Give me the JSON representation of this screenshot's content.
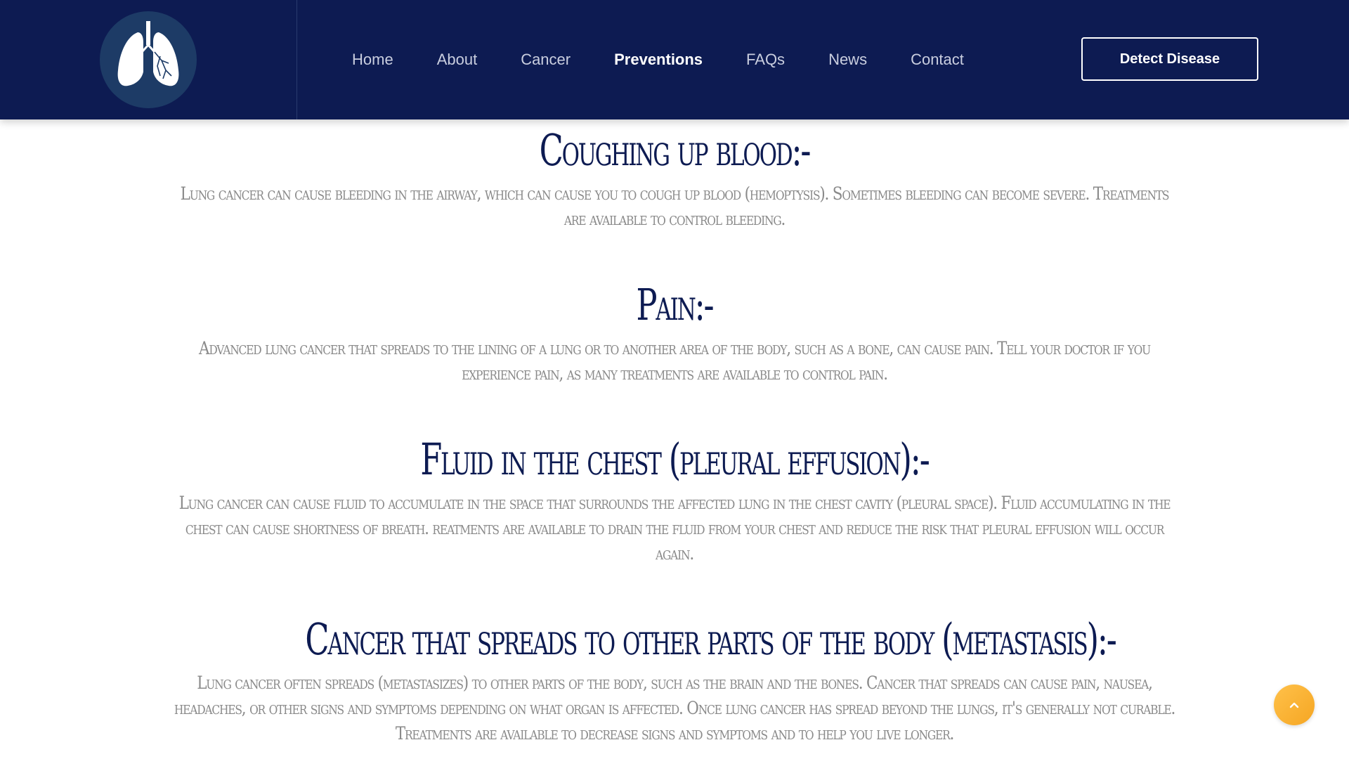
{
  "nav": {
    "links": [
      {
        "label": "Home",
        "active": false
      },
      {
        "label": "About",
        "active": false
      },
      {
        "label": "Cancer",
        "active": false
      },
      {
        "label": "Preventions",
        "active": true
      },
      {
        "label": "FAQs",
        "active": false
      },
      {
        "label": "News",
        "active": false
      },
      {
        "label": "Contact",
        "active": false
      }
    ],
    "cta_label": "Detect Disease"
  },
  "sections": [
    {
      "title": "Coughing up blood:-",
      "text": "Lung cancer can cause bleeding in the airway, which can cause you to cough up blood (hemoptysis). Sometimes bleeding can become severe. Treatments are available to control bleeding."
    },
    {
      "title": "Pain:-",
      "text": "Advanced lung cancer that spreads to the lining of a lung or to another area of the body, such as a bone, can cause pain. Tell your doctor if you experience pain, as many treatments are available to control pain."
    },
    {
      "title": "Fluid in the chest (pleural effusion):-",
      "text": "Lung cancer can cause fluid to accumulate in the space that surrounds the affected lung in the chest cavity (pleural space). Fluid accumulating in the chest can cause shortness of breath. reatments are available to drain the fluid from your chest and reduce the risk that pleural effusion will occur again."
    },
    {
      "title": "Cancer that spreads to other parts of the body (metastasis):-",
      "text": "Lung cancer often spreads (metastasizes) to other parts of the body, such as the brain and the bones. Cancer that spreads can cause pain, nausea, headaches, or other signs and symptoms depending on what organ is affected. Once lung cancer has spread beyond the lungs, it's generally not curable. Treatments are available to decrease signs and symptoms and to help you live longer."
    }
  ],
  "colors": {
    "navbar_bg": "#0d1b52",
    "title_color": "#0d1b52",
    "text_color": "#8a8a8a",
    "scroll_btn": "#f5a623"
  },
  "icons": {
    "logo": "lungs-logo-icon",
    "scroll_top": "chevron-up-icon"
  }
}
